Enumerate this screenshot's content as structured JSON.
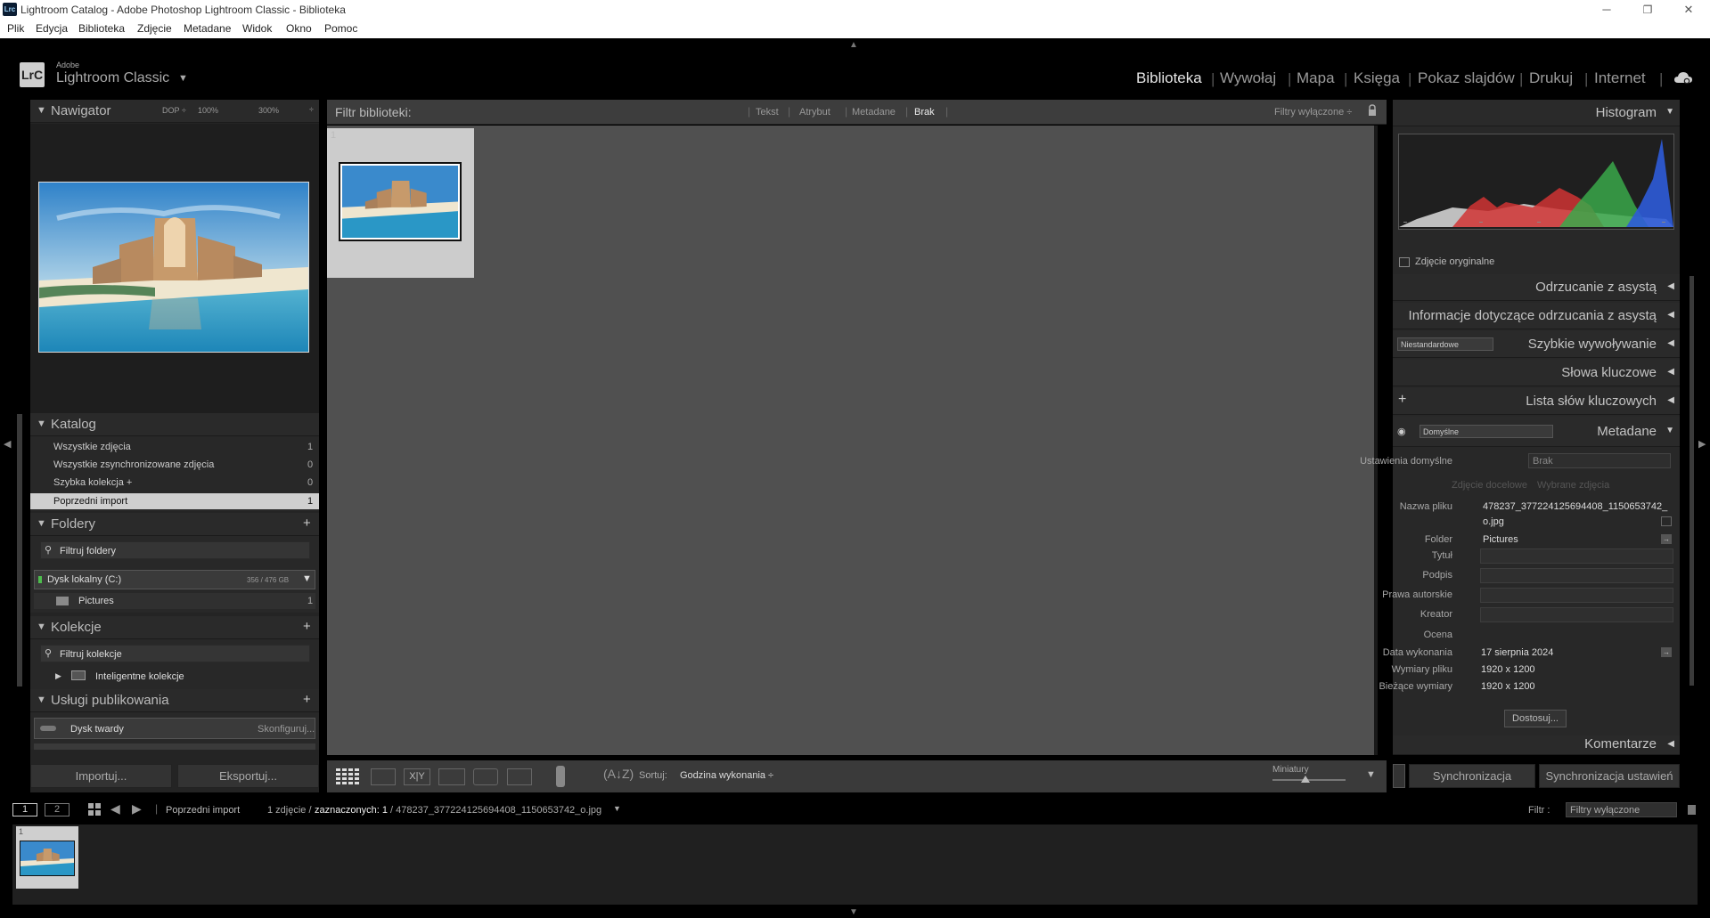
{
  "window": {
    "app_icon": "Lrc",
    "title": "Lightroom Catalog - Adobe Photoshop Lightroom Classic - Biblioteka"
  },
  "menu": [
    "Plik",
    "Edycja",
    "Biblioteka",
    "Zdjęcie",
    "Metadane",
    "Widok",
    "Okno",
    "Pomoc"
  ],
  "header": {
    "logo": "LrC",
    "brand_small": "Adobe",
    "brand": "Lightroom Classic",
    "modules": [
      "Biblioteka",
      "Wywołaj",
      "Mapa",
      "Księga",
      "Pokaz slajdów",
      "Drukuj",
      "Internet"
    ],
    "active_module": "Biblioteka"
  },
  "navigator": {
    "title": "Nawigator",
    "zoom_options": [
      "DOP ÷",
      "100%",
      "300%"
    ]
  },
  "catalog": {
    "title": "Katalog",
    "items": [
      {
        "label": "Wszystkie zdjęcia",
        "count": "1"
      },
      {
        "label": "Wszystkie zsynchronizowane zdjęcia",
        "count": "0"
      },
      {
        "label": "Szybka kolekcja  +",
        "count": "0"
      },
      {
        "label": "Poprzedni import",
        "count": "1"
      }
    ],
    "selected_index": 3
  },
  "folders": {
    "title": "Foldery",
    "filter_placeholder": "Filtruj foldery",
    "volume": "Dysk lokalny (C:)",
    "volume_size": "356 / 476 GB",
    "folder": "Pictures",
    "folder_count": "1"
  },
  "collections": {
    "title": "Kolekcje",
    "filter_placeholder": "Filtruj kolekcje",
    "item": "Inteligentne kolekcje"
  },
  "publish": {
    "title": "Usługi publikowania",
    "service": "Dysk twardy",
    "configure": "Skonfiguruj..."
  },
  "left_buttons": {
    "import": "Importuj...",
    "export": "Eksportuj..."
  },
  "filter_bar": {
    "label": "Filtr biblioteki:",
    "options": [
      "Tekst",
      "Atrybut",
      "Metadane",
      "Brak"
    ],
    "active": "Brak",
    "preset": "Filtry wyłączone ÷"
  },
  "toolbar": {
    "sort_label": "Sortuj:",
    "sort_value": "Godzina wykonania ÷",
    "thumb_label": "Miniatury",
    "thumb_size": 0.45
  },
  "right_panels": {
    "histogram": "Histogram",
    "original_photo": "Zdjęcie oryginalne",
    "ai_denoise": "Odrzucanie z asystą",
    "ai_info": "Informacje dotyczące odrzucania z asystą",
    "quick_develop": "Szybkie wywoływanie",
    "quick_preset": "Niestandardowe",
    "keywording": "Słowa kluczowe",
    "keyword_list": "Lista słów kluczowych",
    "metadata": "Metadane",
    "metadata_preset": "Domyślne",
    "comments": "Komentarze"
  },
  "metadata": {
    "preset_label": "Ustawienia domyślne",
    "preset_value": "Brak",
    "target_photo": "Zdjęcie docelowe",
    "selected_photos": "Wybrane zdjęcia",
    "filename_label": "Nazwa pliku",
    "filename_line1": "478237_377224125694408_1150653742_",
    "filename_line2": "o.jpg",
    "folder_label": "Folder",
    "folder_value": "Pictures",
    "title_label": "Tytuł",
    "caption_label": "Podpis",
    "copyright_label": "Prawa autorskie",
    "creator_label": "Kreator",
    "rating_label": "Ocena",
    "date_label": "Data wykonania",
    "date_value": "17 sierpnia 2024",
    "dims_label": "Wymiary pliku",
    "dims_value": "1920 x 1200",
    "cropped_label": "Bieżące wymiary",
    "cropped_value": "1920 x 1200",
    "customize": "Dostosuj..."
  },
  "sync": {
    "sync": "Synchronizacja",
    "sync_settings": "Synchronizacja ustawień"
  },
  "filmstrip": {
    "screen1": "1",
    "screen2": "2",
    "source": "Poprzedni import",
    "info_prefix": "1 zdjęcie /",
    "info_selected": "zaznaczonych: 1",
    "info_file": "/ 478237_377224125694408_1150653742_o.jpg",
    "filter_label": "Filtr :",
    "filter_value": "Filtry wyłączone",
    "thumb_index": "1"
  },
  "grid": {
    "cell_index": "1"
  },
  "colors": {
    "panel_bg": "#282828",
    "center_bg": "#505050",
    "selected_row": "#cfcfcf",
    "histogram_blue": "#2e5bd8",
    "histogram_green": "#3aa84a",
    "histogram_red": "#d03434"
  },
  "icons": [
    "grid-view-icon",
    "loupe-view-icon",
    "compare-view-icon",
    "survey-view-icon",
    "people-view-icon",
    "painter-icon",
    "sort-direction-icon",
    "cloud-sync-icon",
    "search-icon",
    "folder-icon",
    "eye-icon",
    "lock-icon"
  ]
}
